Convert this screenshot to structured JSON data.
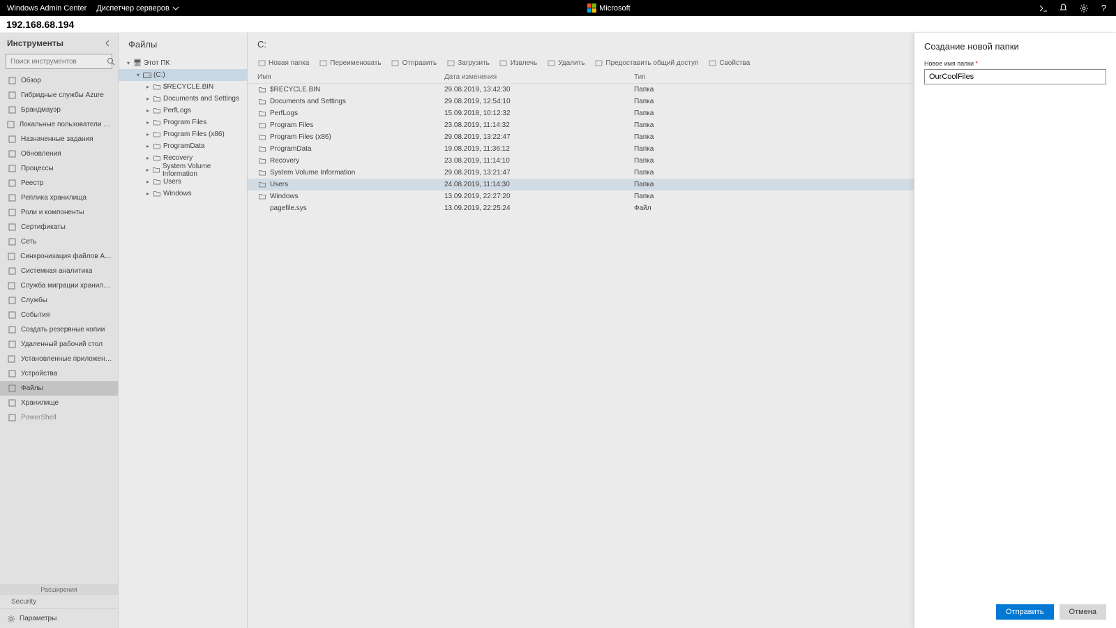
{
  "topbar": {
    "brand": "Windows Admin Center",
    "dropdown": "Диспетчер серверов",
    "ms": "Microsoft"
  },
  "host": "192.168.68.194",
  "sidebar": {
    "title": "Инструменты",
    "search_placeholder": "Поиск инструментов",
    "items": [
      {
        "label": "Обзор",
        "icon": "overview"
      },
      {
        "label": "Гибридные службы Azure",
        "icon": "azure"
      },
      {
        "label": "Брандмауэр",
        "icon": "firewall"
      },
      {
        "label": "Локальные пользователи и группы",
        "icon": "users"
      },
      {
        "label": "Назначенные задания",
        "icon": "tasks"
      },
      {
        "label": "Обновления",
        "icon": "updates"
      },
      {
        "label": "Процессы",
        "icon": "process"
      },
      {
        "label": "Реестр",
        "icon": "registry"
      },
      {
        "label": "Реплика хранилища",
        "icon": "storage-replica"
      },
      {
        "label": "Роли и компоненты",
        "icon": "roles"
      },
      {
        "label": "Сертификаты",
        "icon": "cert"
      },
      {
        "label": "Сеть",
        "icon": "network"
      },
      {
        "label": "Синхронизация файлов Azure",
        "icon": "sync"
      },
      {
        "label": "Системная аналитика",
        "icon": "insights"
      },
      {
        "label": "Служба миграции хранилища",
        "icon": "migration"
      },
      {
        "label": "Службы",
        "icon": "services"
      },
      {
        "label": "События",
        "icon": "events"
      },
      {
        "label": "Создать резервные копии",
        "icon": "backup"
      },
      {
        "label": "Удаленный рабочий стол",
        "icon": "rdp"
      },
      {
        "label": "Установленные приложения",
        "icon": "apps"
      },
      {
        "label": "Устройства",
        "icon": "devices"
      },
      {
        "label": "Файлы",
        "icon": "files",
        "active": true
      },
      {
        "label": "Хранилище",
        "icon": "storage"
      },
      {
        "label": "PowerShell",
        "icon": "ps",
        "dim": true
      }
    ],
    "ext_label": "Расширения",
    "ext_items": [
      "Security"
    ],
    "bottom": "Параметры"
  },
  "tree": {
    "title": "Файлы",
    "root": "Этот ПК",
    "drive": "(C:)",
    "children": [
      "$RECYCLE.BIN",
      "Documents and Settings",
      "PerfLogs",
      "Program Files",
      "Program Files (x86)",
      "ProgramData",
      "Recovery",
      "System Volume Information",
      "Users",
      "Windows"
    ]
  },
  "content": {
    "title": "C:",
    "toolbar": [
      {
        "label": "Новая папка",
        "icon": "new-folder"
      },
      {
        "label": "Переименовать",
        "icon": "rename"
      },
      {
        "label": "Отправить",
        "icon": "upload"
      },
      {
        "label": "Загрузить",
        "icon": "download"
      },
      {
        "label": "Извлечь",
        "icon": "extract"
      },
      {
        "label": "Удалить",
        "icon": "delete"
      },
      {
        "label": "Предоставить общий доступ",
        "icon": "share"
      },
      {
        "label": "Свойства",
        "icon": "props"
      }
    ],
    "columns": {
      "name": "Имя",
      "date": "Дата изменения",
      "type": "Тип"
    },
    "rows": [
      {
        "name": "$RECYCLE.BIN",
        "date": "29.08.2019, 13:42:30",
        "type": "Папка"
      },
      {
        "name": "Documents and Settings",
        "date": "29.08.2019, 12:54:10",
        "type": "Папка"
      },
      {
        "name": "PerfLogs",
        "date": "15.09.2018, 10:12:32",
        "type": "Папка"
      },
      {
        "name": "Program Files",
        "date": "23.08.2019, 11:14:32",
        "type": "Папка"
      },
      {
        "name": "Program Files (x86)",
        "date": "29.08.2019, 13:22:47",
        "type": "Папка"
      },
      {
        "name": "ProgramData",
        "date": "19.08.2019, 11:36:12",
        "type": "Папка"
      },
      {
        "name": "Recovery",
        "date": "23.08.2019, 11:14:10",
        "type": "Папка"
      },
      {
        "name": "System Volume Information",
        "date": "29.08.2019, 13:21:47",
        "type": "Папка"
      },
      {
        "name": "Users",
        "date": "24.08.2019, 11:14:30",
        "type": "Папка",
        "sel": true
      },
      {
        "name": "Windows",
        "date": "13.09.2019, 22:27:20",
        "type": "Папка"
      },
      {
        "name": "pagefile.sys",
        "date": "13.09.2019, 22:25:24",
        "type": "Файл",
        "file": true
      }
    ]
  },
  "panel": {
    "title": "Создание новой папки",
    "label": "Новое имя папки",
    "value": "OurCoolFiles",
    "submit": "Отправить",
    "cancel": "Отмена"
  }
}
